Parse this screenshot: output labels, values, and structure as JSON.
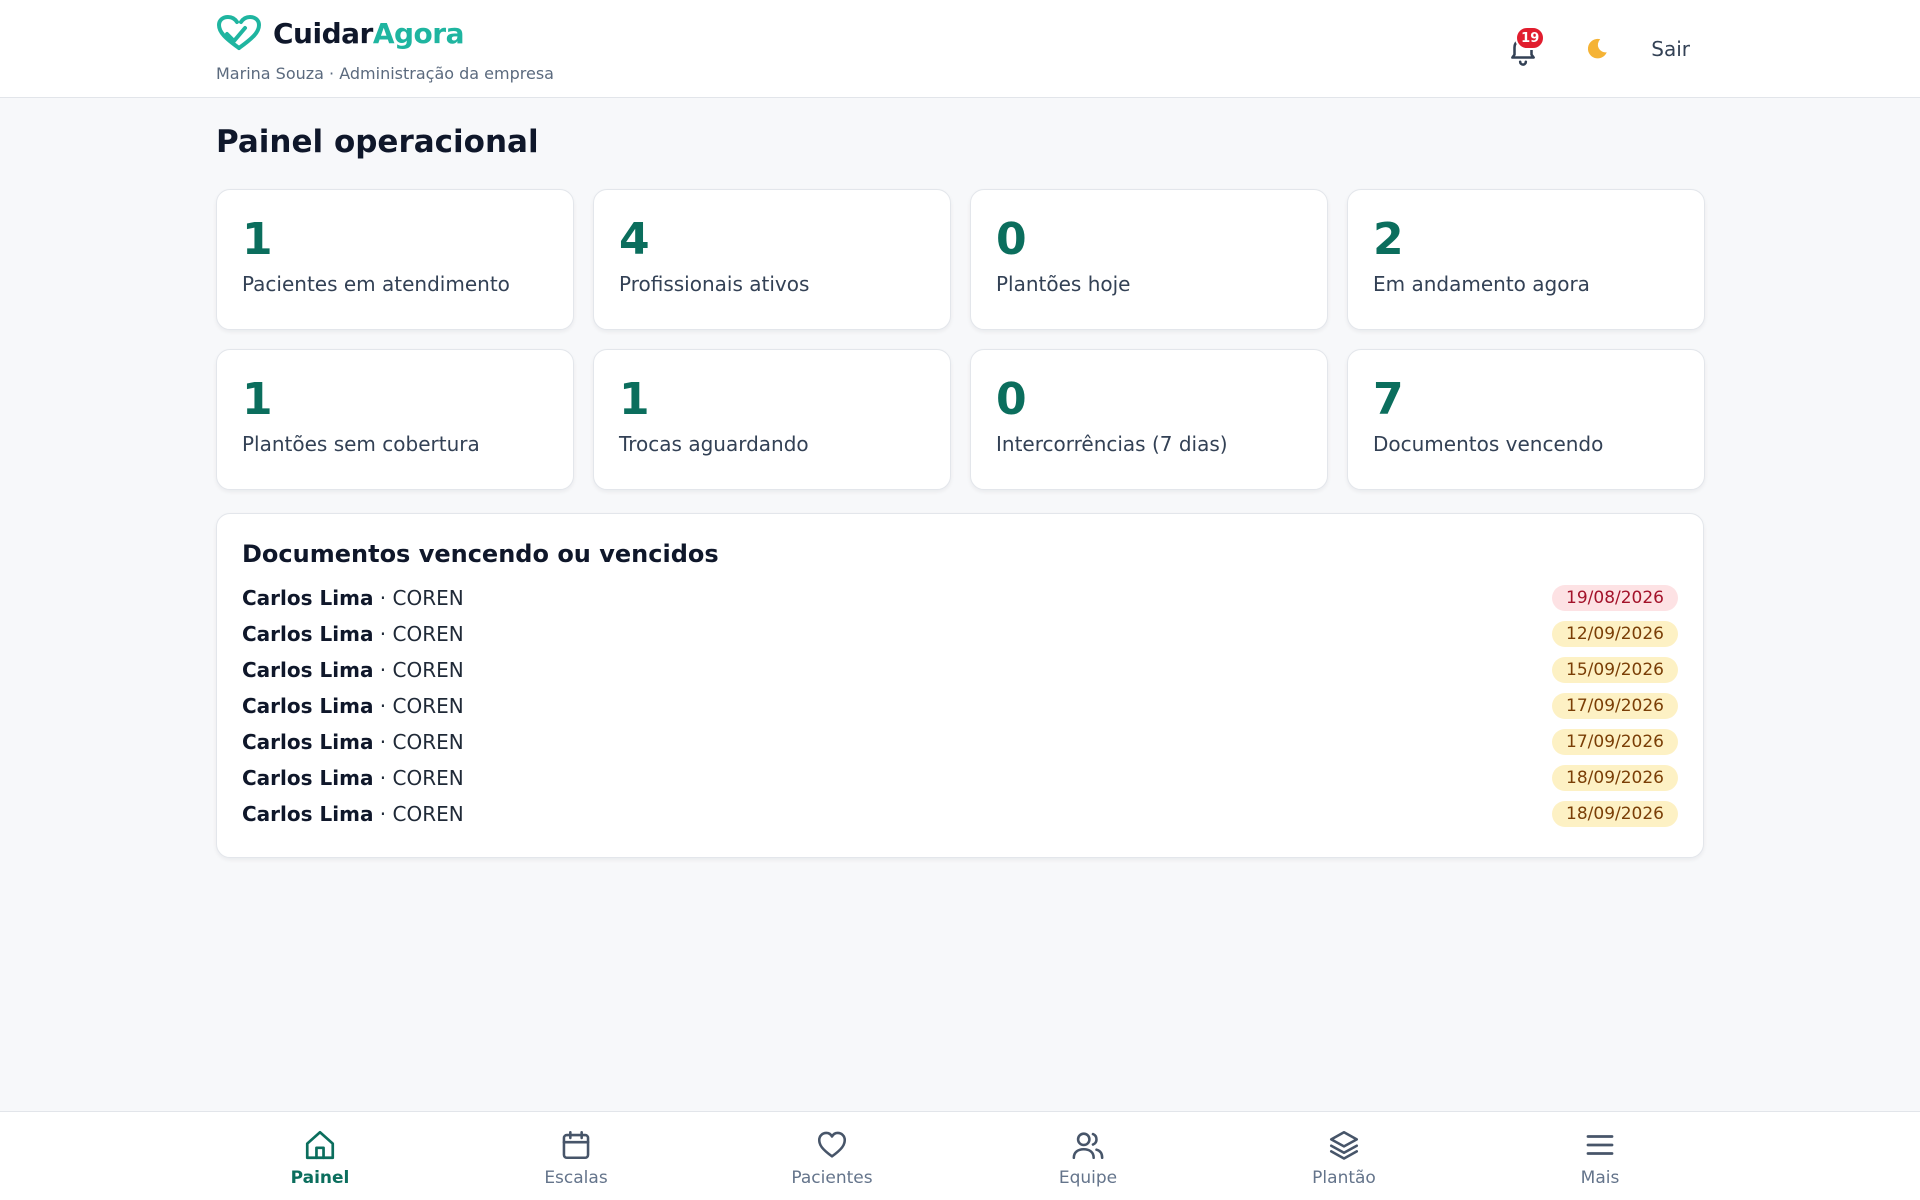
{
  "brand": {
    "name_part1": "Cuidar",
    "name_part2": "Agora",
    "accent": "#1fb5a0"
  },
  "user_line": "Marina Souza · Administração da empresa",
  "header": {
    "notifications_count": "19",
    "logout_label": "Sair",
    "theme_icon": "moon-icon"
  },
  "page_title": "Painel operacional",
  "stats": [
    {
      "value": "1",
      "label": "Pacientes em atendimento"
    },
    {
      "value": "4",
      "label": "Profissionais ativos"
    },
    {
      "value": "0",
      "label": "Plantões hoje"
    },
    {
      "value": "2",
      "label": "Em andamento agora"
    },
    {
      "value": "1",
      "label": "Plantões sem cobertura"
    },
    {
      "value": "1",
      "label": "Trocas aguardando"
    },
    {
      "value": "0",
      "label": "Intercorrências (7 dias)"
    },
    {
      "value": "7",
      "label": "Documentos vencendo"
    }
  ],
  "documents": {
    "title": "Documentos vencendo ou vencidos",
    "items": [
      {
        "name": "Carlos Lima",
        "doc": " · COREN",
        "date": "19/08/2026",
        "status": "red"
      },
      {
        "name": "Carlos Lima",
        "doc": " · COREN",
        "date": "12/09/2026",
        "status": "amber"
      },
      {
        "name": "Carlos Lima",
        "doc": " · COREN",
        "date": "15/09/2026",
        "status": "amber"
      },
      {
        "name": "Carlos Lima",
        "doc": " · COREN",
        "date": "17/09/2026",
        "status": "amber"
      },
      {
        "name": "Carlos Lima",
        "doc": " · COREN",
        "date": "17/09/2026",
        "status": "amber"
      },
      {
        "name": "Carlos Lima",
        "doc": " · COREN",
        "date": "18/09/2026",
        "status": "amber"
      },
      {
        "name": "Carlos Lima",
        "doc": " · COREN",
        "date": "18/09/2026",
        "status": "amber"
      }
    ]
  },
  "bottom_nav": [
    {
      "label": "Painel",
      "icon": "home-icon",
      "active": true
    },
    {
      "label": "Escalas",
      "icon": "calendar-icon",
      "active": false
    },
    {
      "label": "Pacientes",
      "icon": "heart-icon",
      "active": false
    },
    {
      "label": "Equipe",
      "icon": "users-icon",
      "active": false
    },
    {
      "label": "Plantão",
      "icon": "layers-icon",
      "active": false
    },
    {
      "label": "Mais",
      "icon": "menu-icon",
      "active": false
    }
  ],
  "colors": {
    "primary": "#0b6e5d",
    "accent": "#1fb5a0",
    "danger": "#e11d2e"
  }
}
